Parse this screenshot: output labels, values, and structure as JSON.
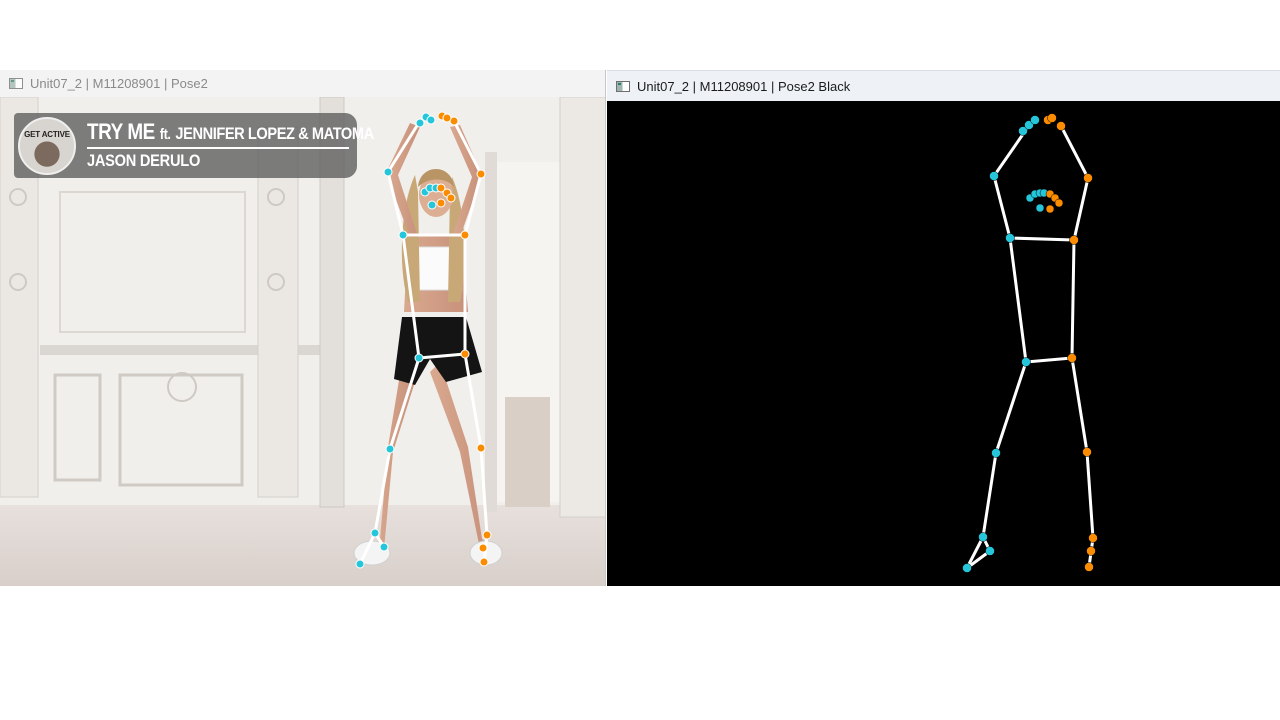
{
  "windows": {
    "left": {
      "title": "Unit07_2 | M11208901 | Pose2"
    },
    "right": {
      "title": "Unit07_2 | M11208901 | Pose2 Black"
    }
  },
  "video_overlay": {
    "logo_text": "GET ACTIVE",
    "song_title": "TRY ME",
    "feat_prefix": "ft.",
    "featuring": "JENNIFER LOPEZ & MATOMA",
    "artist": "JASON DERULO"
  },
  "colors": {
    "left_side_keypoint": "#26c6da",
    "right_side_keypoint": "#fb8c00",
    "skeleton_line": "#ffffff",
    "pose_background": "#000000"
  }
}
